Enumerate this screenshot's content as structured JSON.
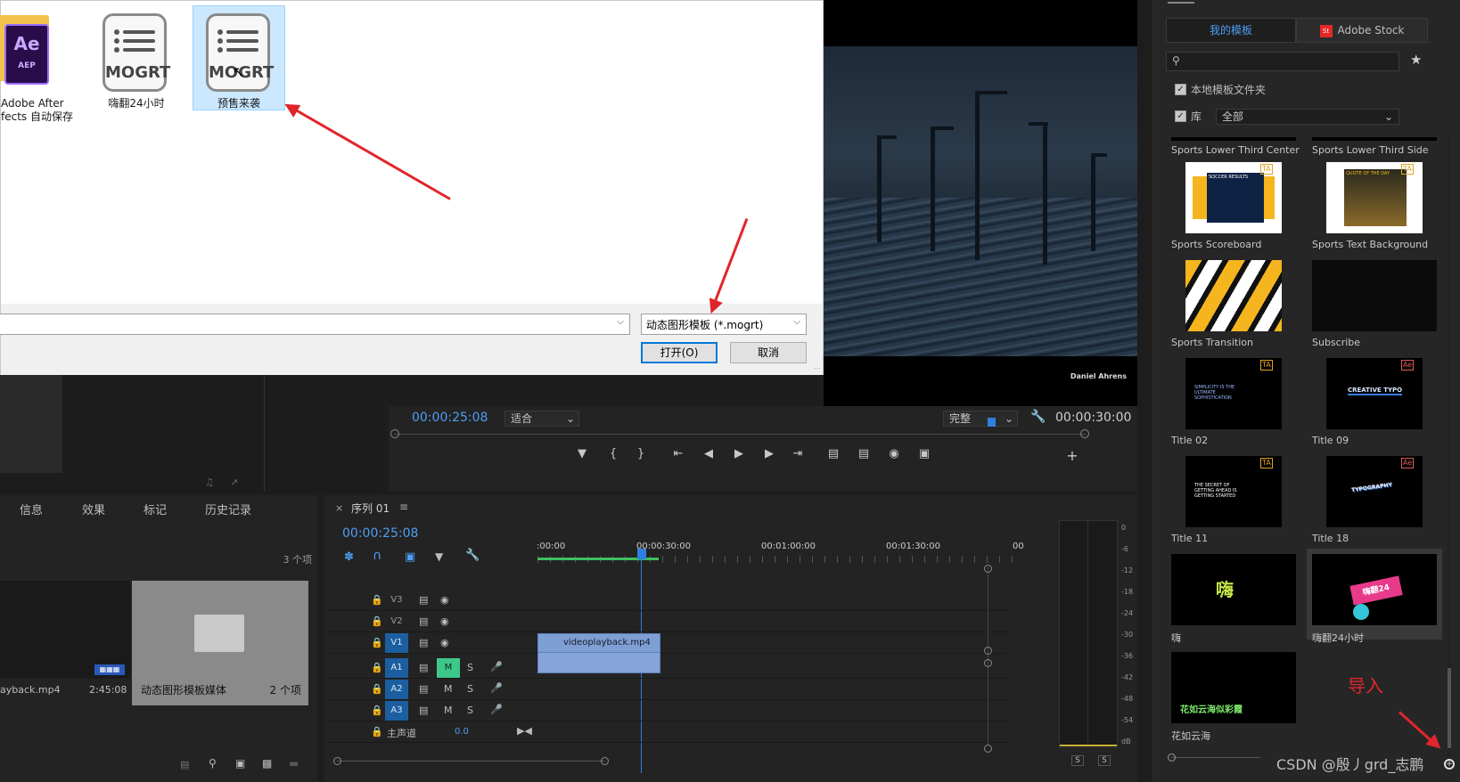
{
  "dialog": {
    "files": [
      {
        "name": "Adobe After\nEffects 自动保存",
        "line1": "Adobe After",
        "line2": "fects 自动保存",
        "icon": "ae-folder-icon"
      },
      {
        "name": "嗨翻24小时",
        "icon": "mogrt-file-icon",
        "icon_text": "MOGRT"
      },
      {
        "name": "预售来袭",
        "icon": "mogrt-file-icon",
        "icon_text": "MOGRT",
        "selected": true
      }
    ],
    "filename_value": "",
    "filetype_value": "动态图形模板 (*.mogrt)",
    "open_label": "打开(O)",
    "cancel_label": "取消"
  },
  "program": {
    "credit": "Daniel Ahrens",
    "timecode_current": "00:00:25:08",
    "fit_value": "适合",
    "quality_value": "完整",
    "timecode_total": "00:00:30:00"
  },
  "bottom_left": {
    "tabs": [
      "信息",
      "效果",
      "标记",
      "历史记录"
    ],
    "item_count": "3 个项",
    "clip_name": "ayback.mp4",
    "clip_duration": "2:45:08",
    "bin_name": "动态图形模板媒体",
    "bin_count": "2 个项"
  },
  "timeline": {
    "tab_label": "序列 01",
    "timecode": "00:00:25:08",
    "ruler": [
      ":00:00",
      "00:00:30:00",
      "00:01:00:00",
      "00:01:30:00",
      "00"
    ],
    "video_tracks": [
      "V3",
      "V2",
      "V1"
    ],
    "audio_tracks": [
      "A1",
      "A2",
      "A3"
    ],
    "master_label": "主声道",
    "master_value": "0.0",
    "clip_label": "videoplayback.mp4 [V]",
    "m_label": "M",
    "s_label": "S"
  },
  "meters": {
    "scale": [
      "0",
      "-6",
      "-12",
      "-18",
      "-24",
      "-30",
      "-36",
      "-42",
      "-48",
      "-54",
      "dB"
    ],
    "solo_left": "S",
    "solo_right": "S"
  },
  "eg": {
    "tab_my": "我的模板",
    "tab_stock": "Adobe Stock",
    "stock_badge": "St",
    "search_placeholder": "",
    "local_folder": "本地模板文件夹",
    "library_label": "库",
    "library_value": "全部",
    "templates": [
      {
        "name": "Sports Lower Third Center"
      },
      {
        "name": "Sports Lower Third Side"
      },
      {
        "name": "Sports Scoreboard",
        "thumb_text": "SOCCER RESULTS"
      },
      {
        "name": "Sports Text Background",
        "thumb_text": "QUOTE OF THE DAY"
      },
      {
        "name": "Sports Transition"
      },
      {
        "name": "Subscribe"
      },
      {
        "name": "Title 02",
        "thumb_text": "SIMPLICITY IS THE ULTIMATE SOPHISTICATION"
      },
      {
        "name": "Title 09",
        "thumb_text": "CREATIVE TYPO"
      },
      {
        "name": "Title 11",
        "thumb_text": "THE SECRET OF GETTING AHEAD IS GETTING STARTED"
      },
      {
        "name": "Title 18",
        "thumb_text": "TYPOGRAPHY"
      },
      {
        "name": "嗨",
        "thumb_text": "嗨"
      },
      {
        "name": "嗨翻24小时",
        "thumb_text": "嗨翻24"
      },
      {
        "name": "花如云海",
        "thumb_text": "花如云海似彩霞"
      }
    ],
    "annotation": "导入",
    "watermark": "CSDN @殷丿grd_志鹏"
  },
  "colors": {
    "accent_blue": "#4d9ef5",
    "annotation_red": "#e0262b",
    "clip_blue": "#7e9fd4"
  }
}
